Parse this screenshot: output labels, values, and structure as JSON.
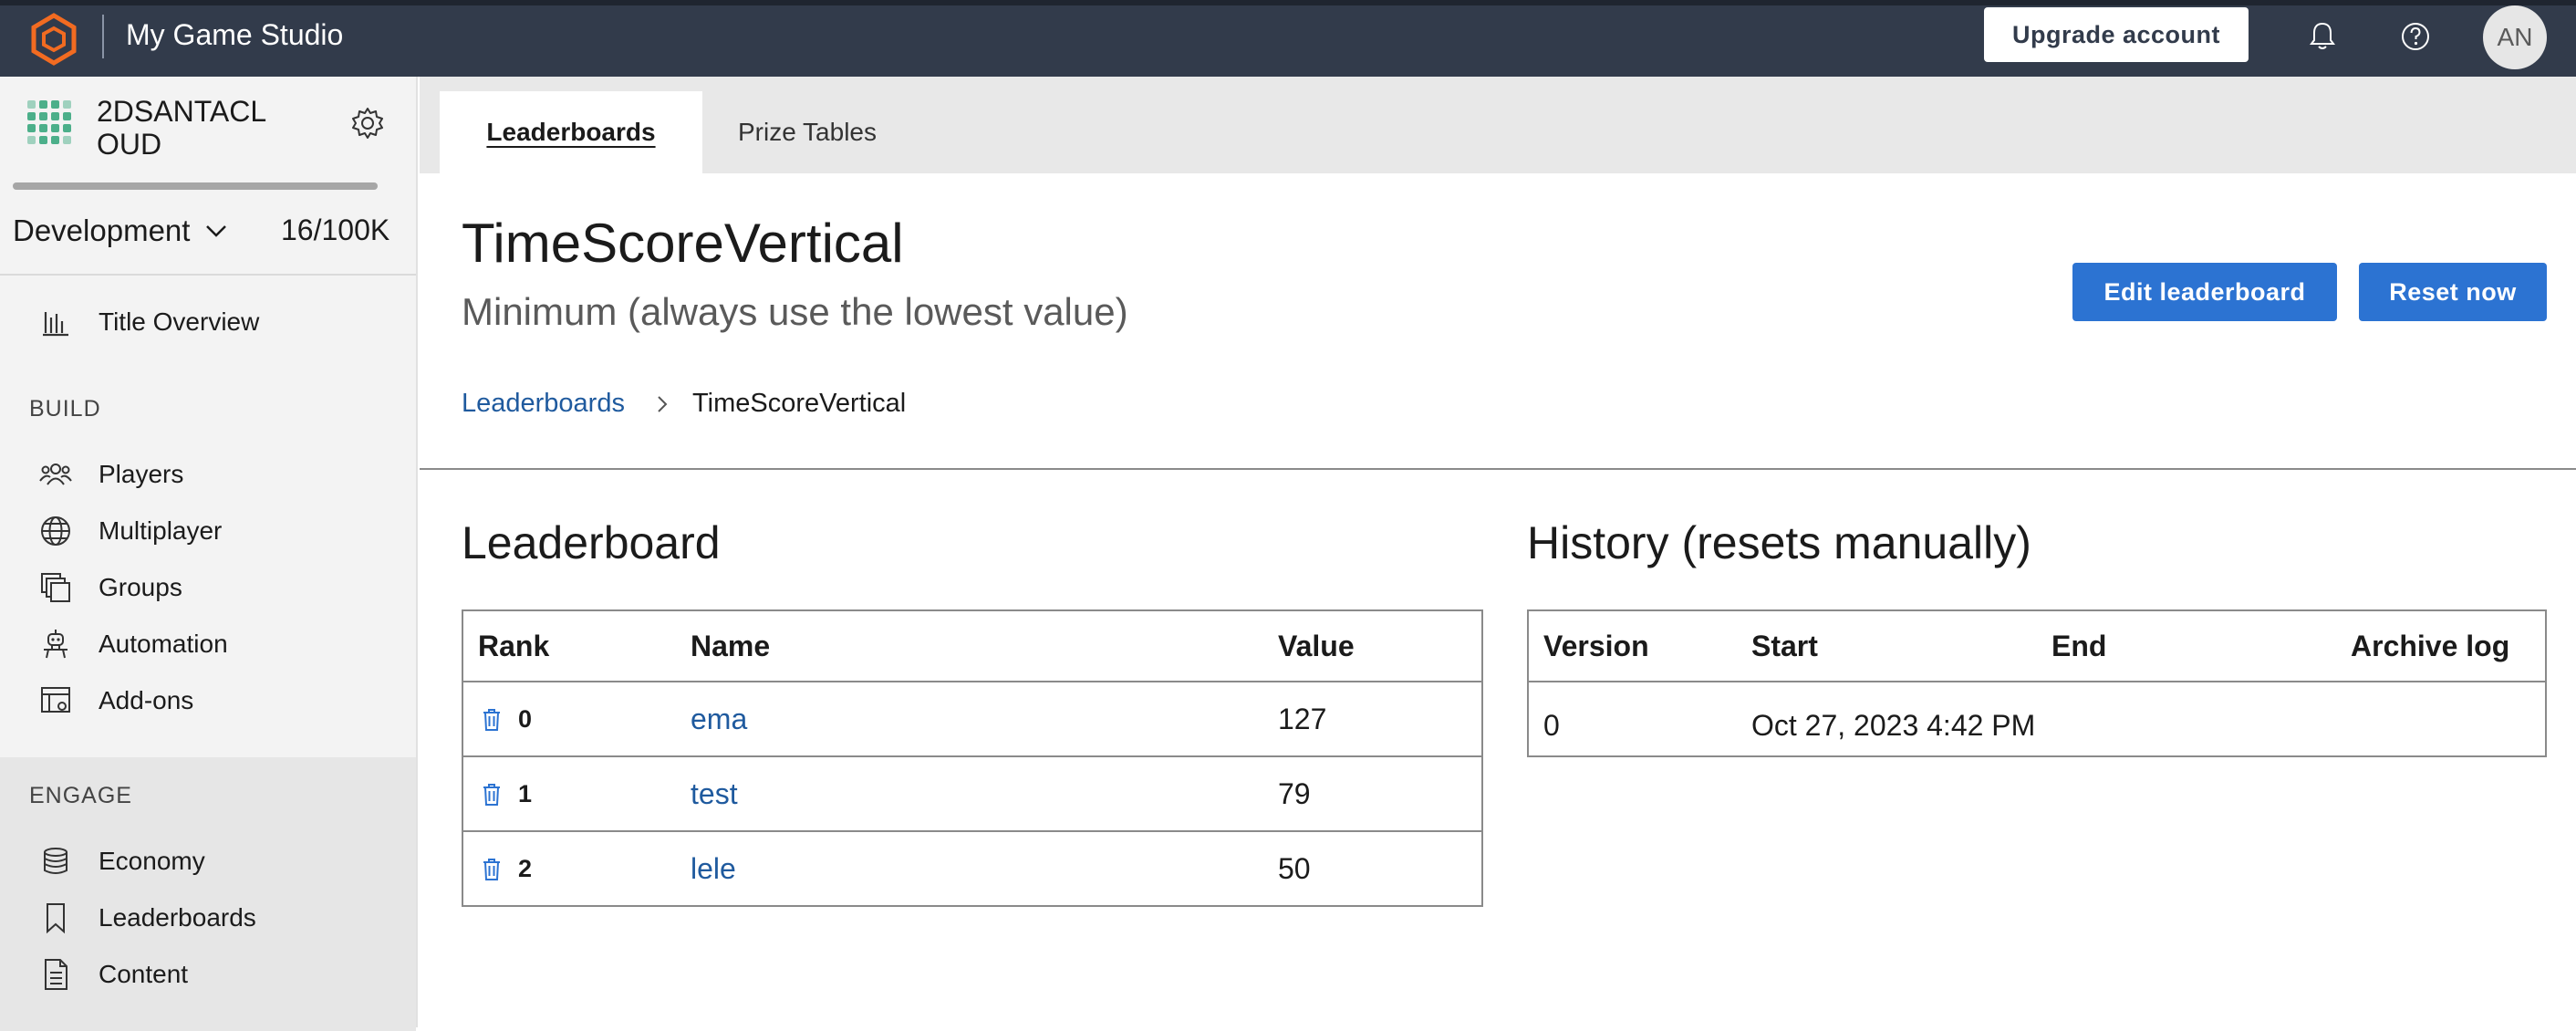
{
  "app": {
    "title": "My Game Studio",
    "upgrade_label": "Upgrade account",
    "avatar_initials": "AN"
  },
  "sidebar": {
    "title_name": "2DSANTACLOUD",
    "environment": "Development",
    "usage": "16/100K",
    "usage_fraction": 0.00016,
    "items": {
      "overview": "Title Overview",
      "build_header": "BUILD",
      "players": "Players",
      "multiplayer": "Multiplayer",
      "groups": "Groups",
      "automation": "Automation",
      "addons": "Add-ons",
      "engage_header": "ENGAGE",
      "economy": "Economy",
      "leaderboards": "Leaderboards",
      "content": "Content"
    }
  },
  "tabs": {
    "leaderboards": "Leaderboards",
    "prize_tables": "Prize Tables"
  },
  "page": {
    "title": "TimeScoreVertical",
    "subtitle": "Minimum (always use the lowest value)",
    "edit_label": "Edit leaderboard",
    "reset_label": "Reset now",
    "breadcrumb_root": "Leaderboards",
    "breadcrumb_current": "TimeScoreVertical"
  },
  "leaderboard": {
    "heading": "Leaderboard",
    "columns": {
      "rank": "Rank",
      "name": "Name",
      "value": "Value"
    },
    "rows": [
      {
        "rank": "0",
        "name": "ema",
        "value": "127"
      },
      {
        "rank": "1",
        "name": "test",
        "value": "79"
      },
      {
        "rank": "2",
        "name": "lele",
        "value": "50"
      }
    ]
  },
  "history": {
    "heading": "History (resets manually)",
    "columns": {
      "version": "Version",
      "start": "Start",
      "end": "End",
      "archive": "Archive log"
    },
    "rows": [
      {
        "version": "0",
        "start": "Oct 27, 2023 4:42 PM",
        "end": "",
        "archive": ""
      }
    ]
  },
  "colors": {
    "topbar": "#323b4b",
    "accent": "#2c73d2",
    "link": "#1f5a9e",
    "logo": "#f26b21"
  }
}
